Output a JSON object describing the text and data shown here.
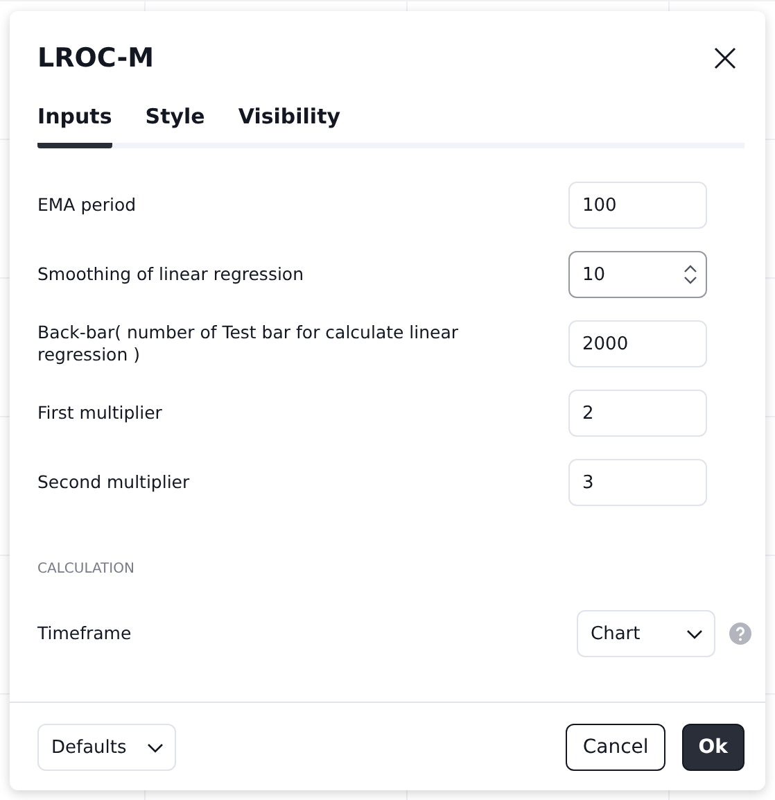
{
  "dialog": {
    "title": "LROC-M"
  },
  "tabs": [
    {
      "label": "Inputs",
      "selected": true
    },
    {
      "label": "Style",
      "selected": false
    },
    {
      "label": "Visibility",
      "selected": false
    }
  ],
  "inputs": [
    {
      "label": "EMA period",
      "value": "100",
      "focused": false
    },
    {
      "label": "Smoothing of linear regression",
      "value": "10",
      "focused": true
    },
    {
      "label": "Back-bar( number of Test bar for calculate linear regression )",
      "value": "2000",
      "focused": false
    },
    {
      "label": "First multiplier",
      "value": "2",
      "focused": false
    },
    {
      "label": "Second multiplier",
      "value": "3",
      "focused": false
    }
  ],
  "section": {
    "heading": "CALCULATION",
    "fields": [
      {
        "label": "Timeframe",
        "value": "Chart"
      }
    ]
  },
  "footer": {
    "defaults": "Defaults",
    "cancel": "Cancel",
    "ok": "Ok"
  }
}
